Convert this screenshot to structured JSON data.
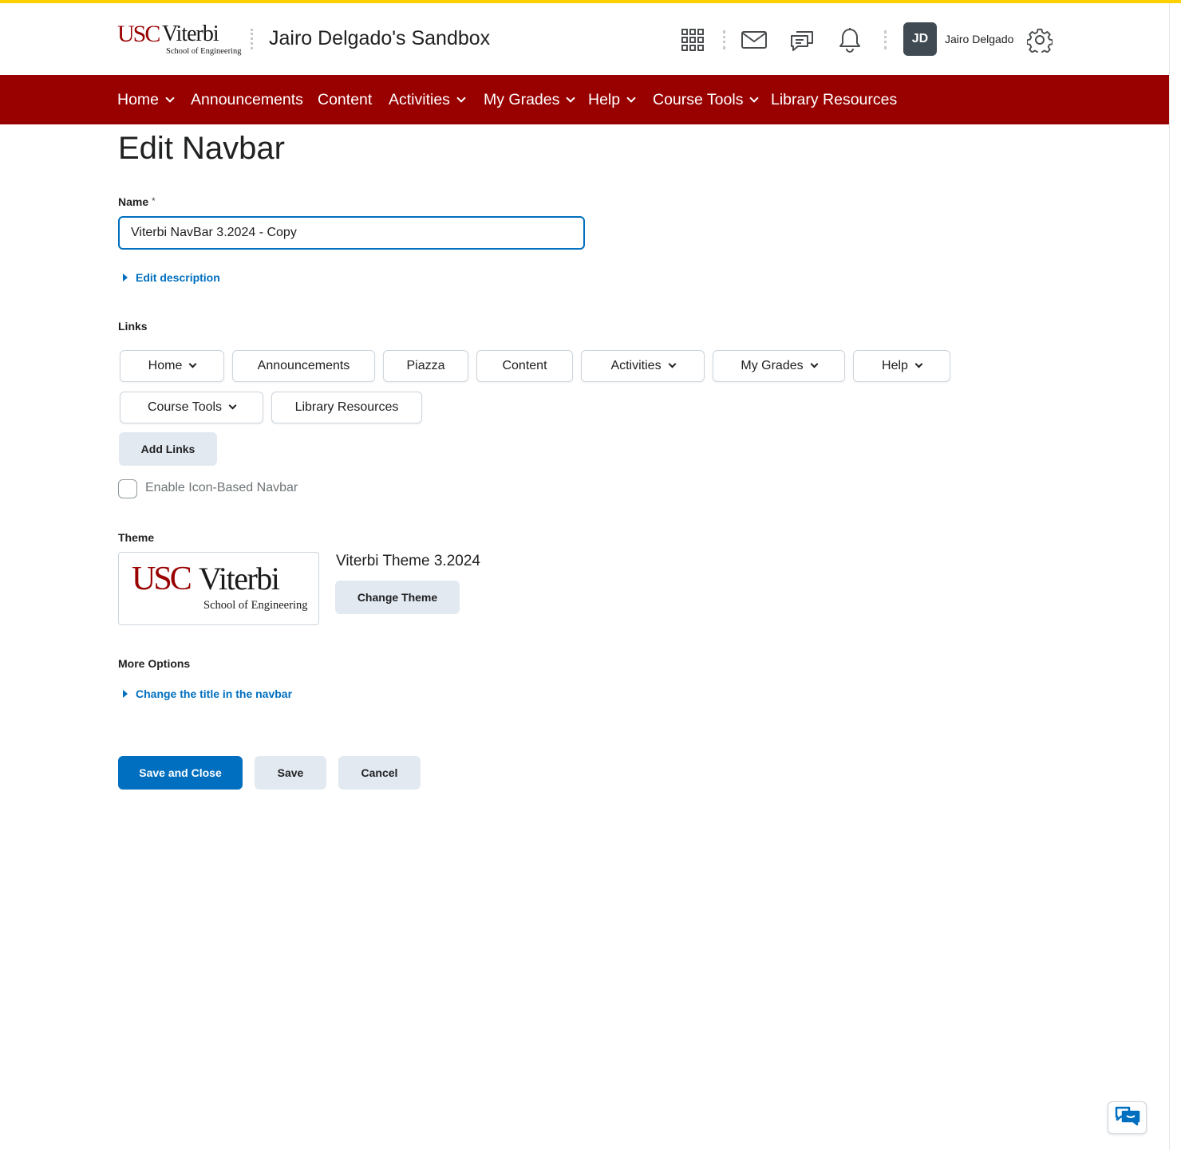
{
  "colors": {
    "accent_stripe": "#ffd100",
    "navbar_bg": "#990000",
    "primary": "#006fbf",
    "button_bg": "#e3e9f1"
  },
  "header": {
    "logo": {
      "usc": "USC",
      "viterbi": "Viterbi",
      "school": "School of Engineering"
    },
    "course_title": "Jairo Delgado's Sandbox",
    "icons": [
      "waffle-grid-icon",
      "mail-icon",
      "chat-bubbles-icon",
      "bell-icon",
      "gear-icon"
    ],
    "user": {
      "initials": "JD",
      "name": "Jairo Delgado"
    }
  },
  "navbar": {
    "items": [
      {
        "label": "Home",
        "dropdown": true
      },
      {
        "label": "Announcements",
        "dropdown": false
      },
      {
        "label": "Content",
        "dropdown": false
      },
      {
        "label": "Activities",
        "dropdown": true
      },
      {
        "label": "My Grades",
        "dropdown": true
      },
      {
        "label": "Help",
        "dropdown": true
      },
      {
        "label": "Course Tools",
        "dropdown": true
      },
      {
        "label": "Library Resources",
        "dropdown": false
      }
    ]
  },
  "main": {
    "title": "Edit Navbar",
    "name_label": "Name",
    "required_mark": "*",
    "name_value": "Viterbi NavBar 3.2024 - Copy",
    "edit_description": "Edit description",
    "links_label": "Links",
    "links": [
      {
        "label": "Home",
        "dropdown": true
      },
      {
        "label": "Announcements",
        "dropdown": false
      },
      {
        "label": "Piazza",
        "dropdown": false
      },
      {
        "label": "Content",
        "dropdown": false
      },
      {
        "label": "Activities",
        "dropdown": true
      },
      {
        "label": "My Grades",
        "dropdown": true
      },
      {
        "label": "Help",
        "dropdown": true
      },
      {
        "label": "Course Tools",
        "dropdown": true
      },
      {
        "label": "Library Resources",
        "dropdown": false
      }
    ],
    "add_links": "Add Links",
    "icon_navbar_label": "Enable Icon-Based Navbar",
    "icon_navbar_checked": false,
    "theme_label": "Theme",
    "theme_logo": {
      "usc": "USC",
      "viterbi": "Viterbi",
      "school": "School of Engineering"
    },
    "theme_name": "Viterbi Theme 3.2024",
    "change_theme": "Change Theme",
    "more_options_label": "More Options",
    "change_title": "Change the title in the navbar"
  },
  "footer_buttons": {
    "save_close": "Save and Close",
    "save": "Save",
    "cancel": "Cancel"
  },
  "chat_fab_icon": "chat-support-icon"
}
